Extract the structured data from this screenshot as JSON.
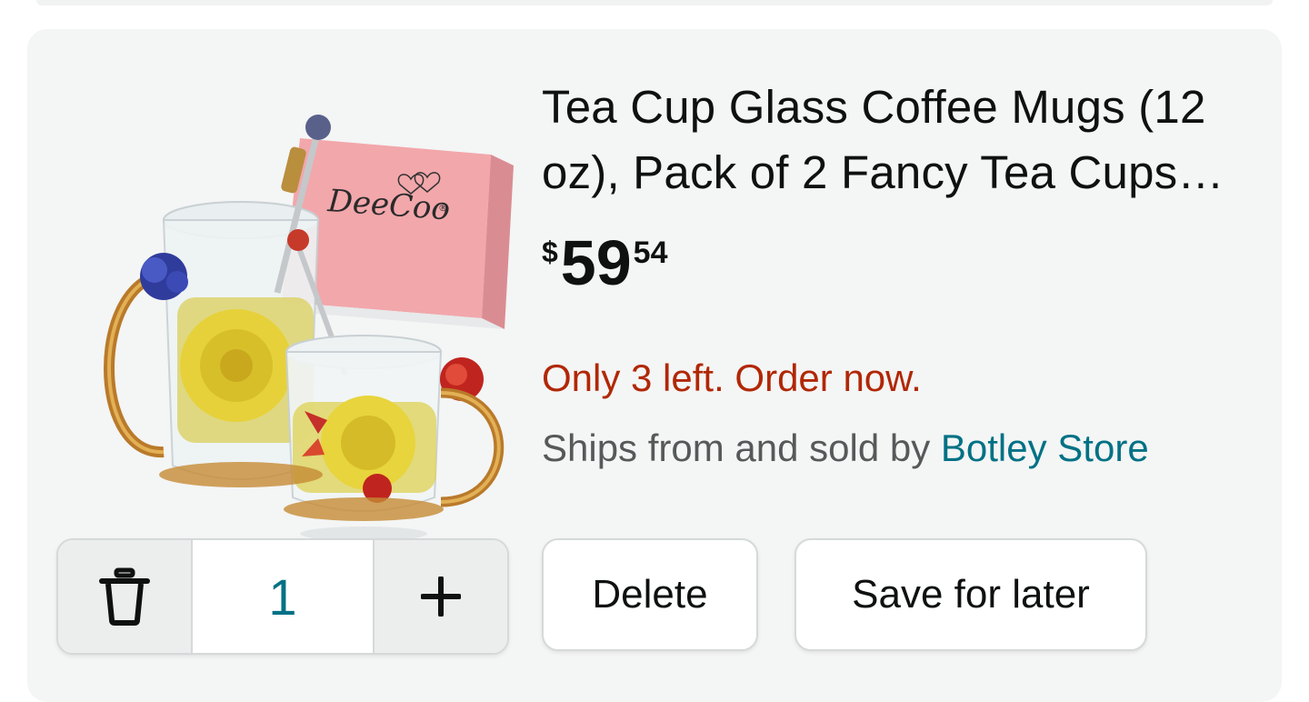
{
  "product": {
    "title": "Tea Cup Glass Coffee Mugs (12 oz), Pack of 2 Fancy Tea Cups…",
    "price": {
      "symbol": "$",
      "whole": "59",
      "fraction": "54"
    },
    "stock_message": "Only 3 left. Order now.",
    "seller_prefix": "Ships from and sold by ",
    "seller_name": "Botley Store",
    "image": {
      "brand_text": "DeeCoo",
      "registered_mark": "®"
    }
  },
  "quantity": {
    "value": "1",
    "delete_icon": "trash-icon",
    "increment_icon": "plus-icon"
  },
  "actions": {
    "delete_label": "Delete",
    "save_label": "Save for later"
  },
  "colors": {
    "stock_red": "#b12704",
    "link_teal": "#007185",
    "text": "#0f1111",
    "muted": "#565959"
  }
}
